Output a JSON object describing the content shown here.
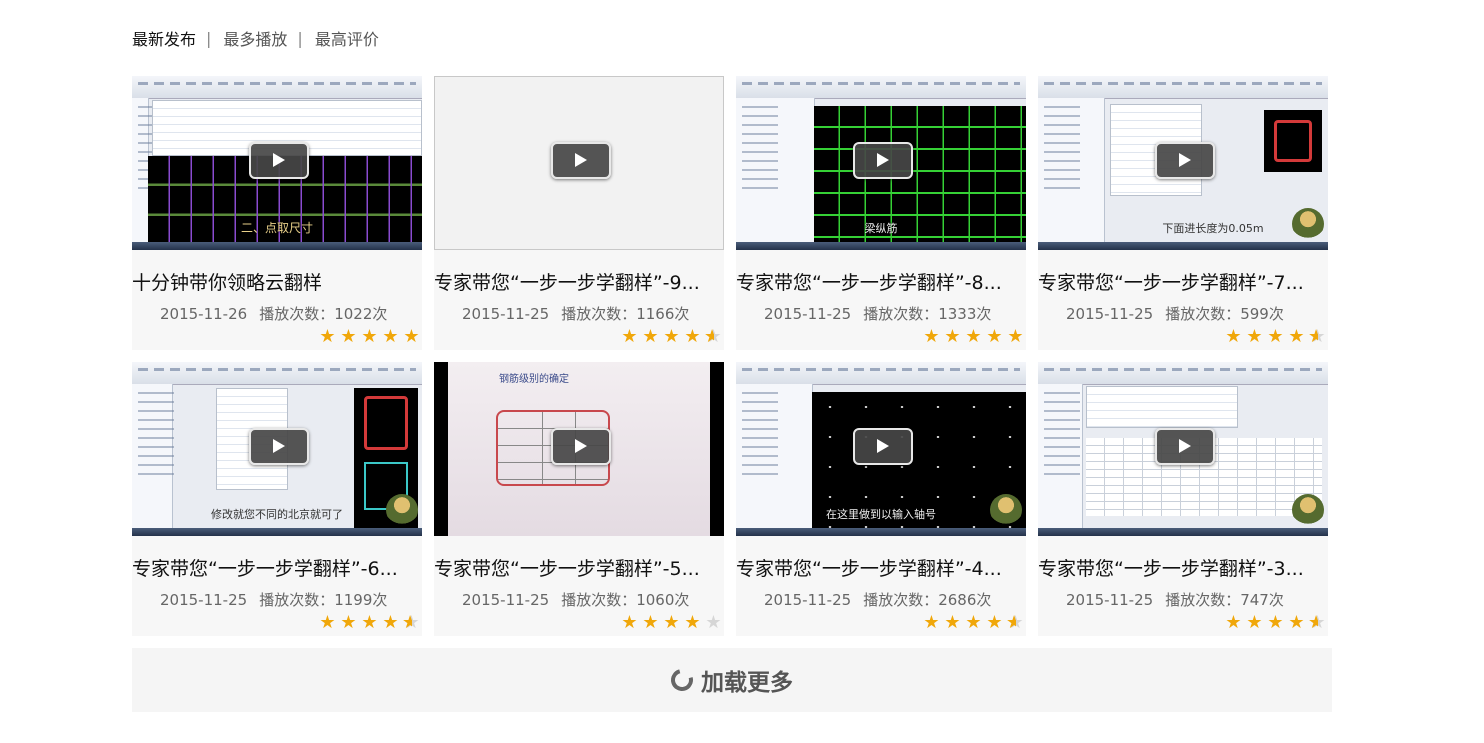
{
  "tabs": [
    "最新发布",
    "最多播放",
    "最高评价"
  ],
  "active_tab": 0,
  "videos": [
    {
      "title": "十分钟带你领略云翻样",
      "date": "2015-11-26",
      "plays": "播放次数：1022次",
      "rating": 5,
      "thumb_caption": "二、点取尺寸"
    },
    {
      "title": "专家带您“一步一步学翻样”-9...",
      "date": "2015-11-25",
      "plays": "播放次数：1166次",
      "rating": 4.5,
      "thumb_caption": ""
    },
    {
      "title": "专家带您“一步一步学翻样”-8...",
      "date": "2015-11-25",
      "plays": "播放次数：1333次",
      "rating": 5,
      "thumb_caption": "梁纵筋"
    },
    {
      "title": "专家带您“一步一步学翻样”-7...",
      "date": "2015-11-25",
      "plays": "播放次数：599次",
      "rating": 4.5,
      "thumb_caption": "下面进长度为0.05m"
    },
    {
      "title": "专家带您“一步一步学翻样”-6...",
      "date": "2015-11-25",
      "plays": "播放次数：1199次",
      "rating": 4.5,
      "thumb_caption": "修改就您不同的北京就可了"
    },
    {
      "title": "专家带您“一步一步学翻样”-5...",
      "date": "2015-11-25",
      "plays": "播放次数：1060次",
      "rating": 4,
      "thumb_caption": "钢筋级别的确定"
    },
    {
      "title": "专家带您“一步一步学翻样”-4...",
      "date": "2015-11-25",
      "plays": "播放次数：2686次",
      "rating": 4.5,
      "thumb_caption": "在这里做到以输入轴号"
    },
    {
      "title": "专家带您“一步一步学翻样”-3...",
      "date": "2015-11-25",
      "plays": "播放次数：747次",
      "rating": 4.5,
      "thumb_caption": ""
    }
  ],
  "load_more": "加载更多",
  "icons": {
    "play": "play-icon",
    "star": "star-icon",
    "loading": "loading-spinner-icon"
  },
  "colors": {
    "star": "#f0a70a",
    "star_empty": "#d6d6d6",
    "card_bg": "#f7f7f7"
  }
}
